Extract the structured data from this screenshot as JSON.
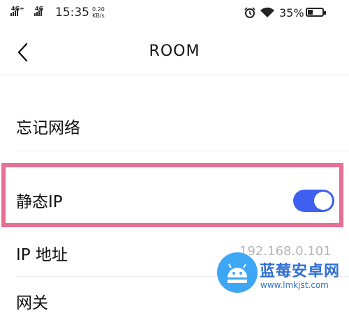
{
  "status_bar": {
    "net1": "4G+",
    "net2": "4G",
    "time": "15:35",
    "speed_value": "0.20",
    "speed_unit": "KB/s",
    "battery_percent": "35%",
    "battery_level": 0.35,
    "icons": [
      "signal-icon",
      "alarm-icon",
      "wifi-icon",
      "battery-icon"
    ]
  },
  "header": {
    "back_icon": "chevron-left-icon",
    "title": "ROOM"
  },
  "settings": {
    "forget_network": "忘记网络",
    "static_ip": "静态IP",
    "static_ip_enabled": true,
    "ip_address_label": "IP 地址",
    "ip_address_value": "192.168.0.101",
    "next_row_label": "网关"
  },
  "colors": {
    "toggle_on": "#3f5ff0",
    "highlight_border": "#e66f94",
    "value_text": "#b5b5b5"
  },
  "watermark": {
    "name": "蓝莓安卓网",
    "url": "www.lmkjst.com"
  }
}
